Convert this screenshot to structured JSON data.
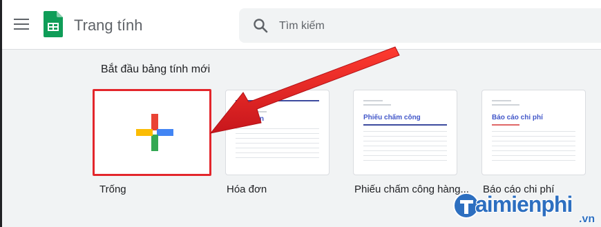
{
  "header": {
    "menu_icon": "hamburger-menu-icon",
    "app_icon": "google-sheets-icon",
    "app_title": "Trang tính",
    "search": {
      "placeholder": "Tìm kiếm",
      "icon": "search-icon"
    }
  },
  "gallery": {
    "title": "Bắt đầu bảng tính mới",
    "templates": [
      {
        "label": "Trống",
        "thumb": {
          "icon": "multicolor-plus-icon"
        },
        "highlighted": true,
        "highlight_color": "#e3262b"
      },
      {
        "label": "Hóa đơn",
        "thumb": {
          "heading": "Hóa đơn"
        }
      },
      {
        "label": "Phiếu chấm công hàng...",
        "thumb": {
          "heading": "Phiếu chấm công"
        }
      },
      {
        "label": "Báo cáo chi phí",
        "thumb": {
          "heading": "Báo cáo chi phí"
        }
      }
    ]
  },
  "annotation": {
    "arrow_color": "#e3262b",
    "points_to": "Trống"
  },
  "watermark": {
    "text": "aimienphi",
    "suffix": ".vn"
  },
  "colors": {
    "sheets_green": "#0f9d58",
    "plus_blue": "#4285f4",
    "plus_red": "#ea4335",
    "plus_yellow": "#fbbc04",
    "plus_green": "#34a853",
    "watermark_blue": "#2d6fc0"
  }
}
